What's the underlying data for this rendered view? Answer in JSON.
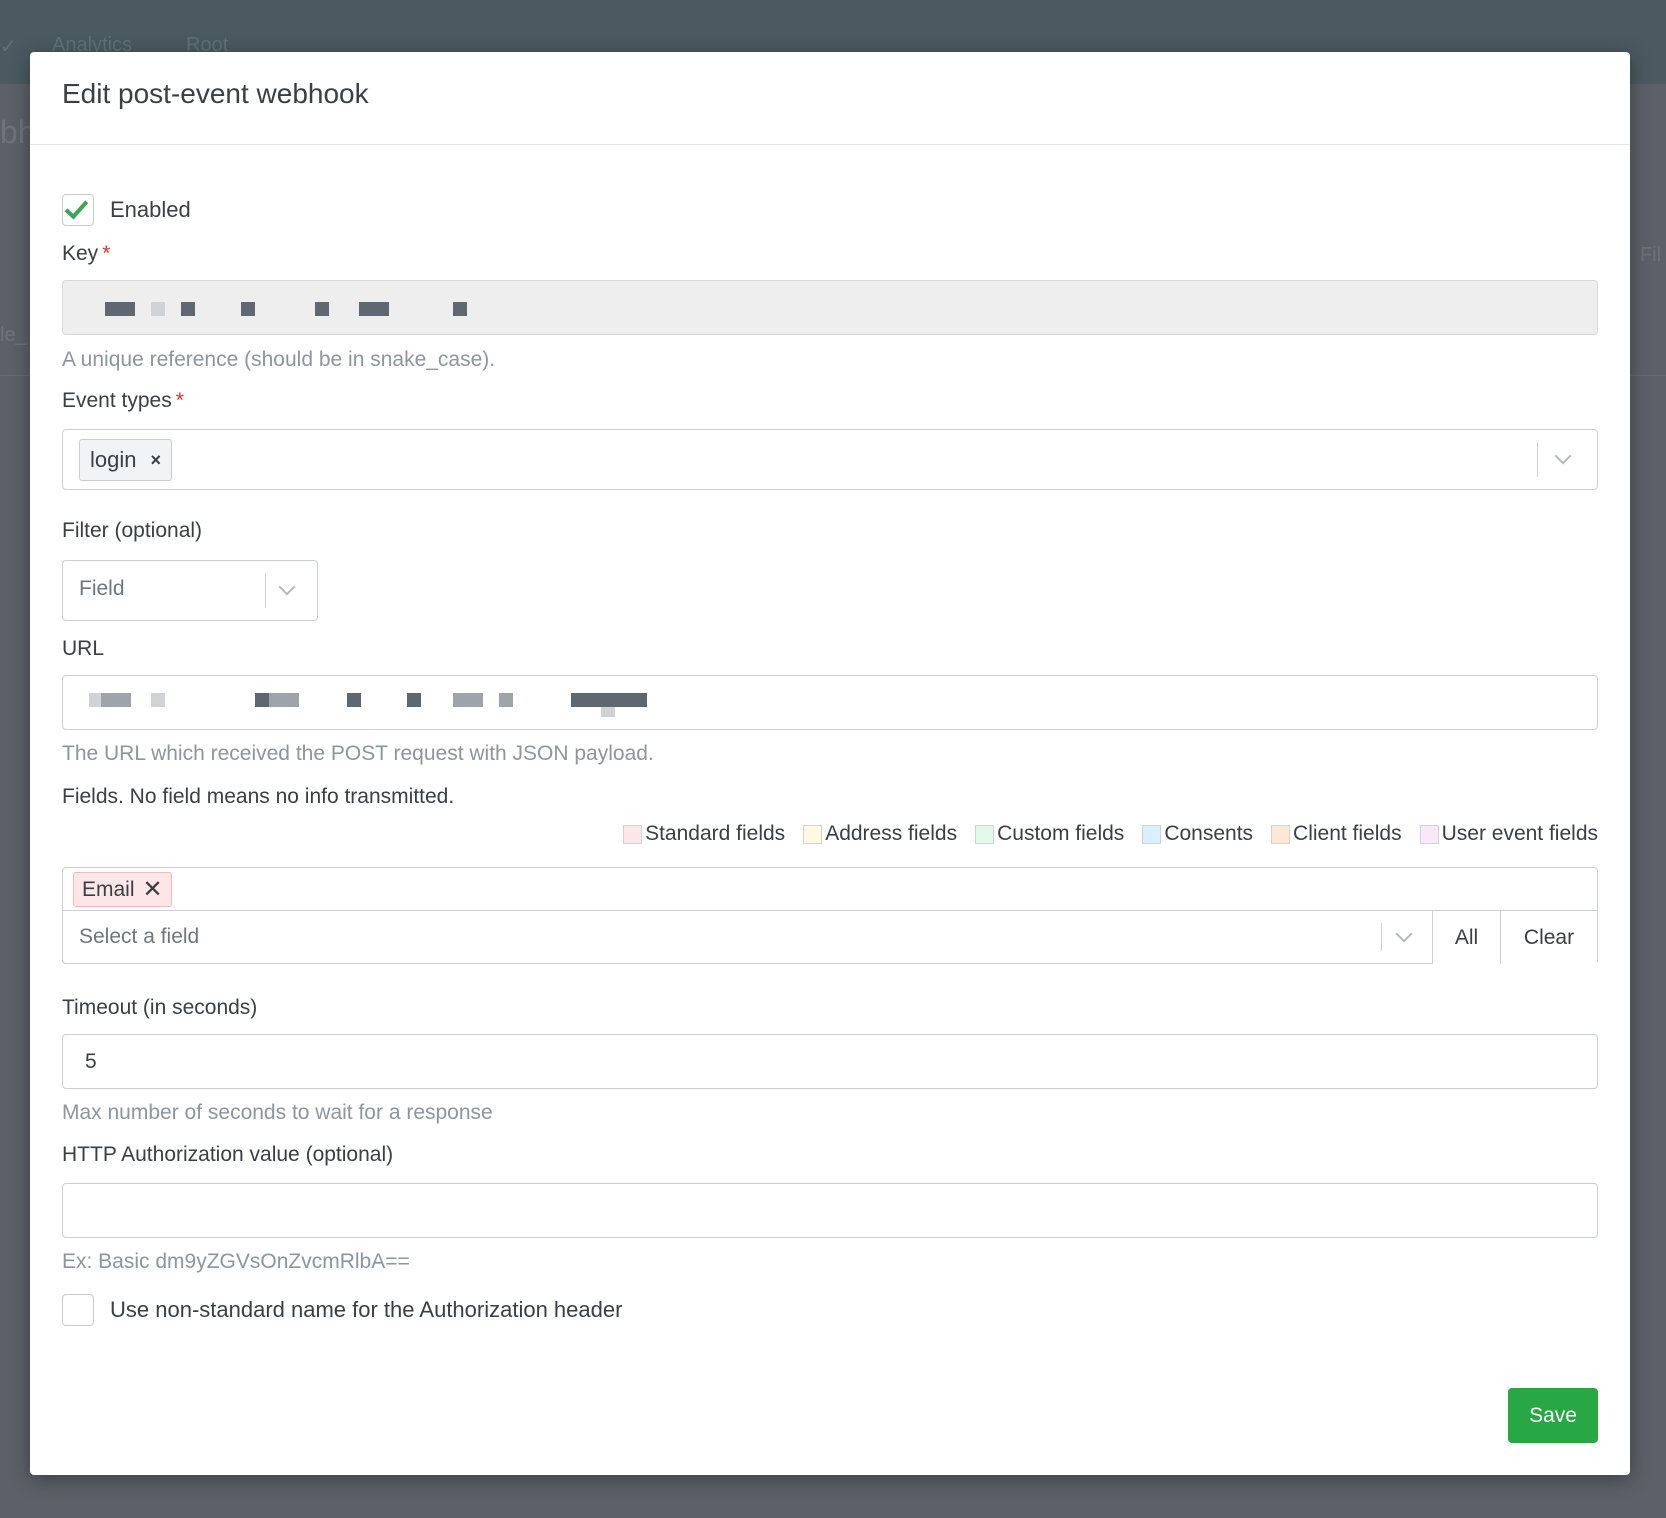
{
  "background": {
    "nav": [
      "Analytics",
      "Root"
    ],
    "page_title_fragment": "bh",
    "side_fragment": "Fil",
    "row_fragment": "le_"
  },
  "modal": {
    "title": "Edit post-event webhook",
    "enabled": {
      "label": "Enabled",
      "checked": true
    },
    "key": {
      "label": "Key",
      "required_mark": "*",
      "help": "A unique reference (should be in snake_case)."
    },
    "event_types": {
      "label": "Event types",
      "required_mark": "*",
      "selected": [
        {
          "label": "login",
          "remove_glyph": "×"
        }
      ]
    },
    "filter": {
      "label": "Filter (optional)",
      "placeholder": "Field"
    },
    "url": {
      "label": "URL",
      "help": "The URL which received the POST request with JSON payload."
    },
    "fields": {
      "label": "Fields. No field means no info transmitted.",
      "legend": [
        {
          "label": "Standard fields",
          "color": "#fde6e8"
        },
        {
          "label": "Address fields",
          "color": "#fdf9e3"
        },
        {
          "label": "Custom fields",
          "color": "#e2f8e9"
        },
        {
          "label": "Consents",
          "color": "#dcefff"
        },
        {
          "label": "Client fields",
          "color": "#fde8d8"
        },
        {
          "label": "User event fields",
          "color": "#f9e8f9"
        }
      ],
      "selected": [
        {
          "label": "Email",
          "remove_glyph": "✕"
        }
      ],
      "select_placeholder": "Select a field",
      "all_label": "All",
      "clear_label": "Clear"
    },
    "timeout": {
      "label": "Timeout (in seconds)",
      "value": "5",
      "help": "Max number of seconds to wait for a response"
    },
    "auth": {
      "label": "HTTP Authorization value (optional)",
      "value": "",
      "help": "Ex: Basic dm9yZGVsOnZvcmRlbA=="
    },
    "nonstandard_header": {
      "label": "Use non-standard name for the Authorization header",
      "checked": false
    },
    "save_label": "Save",
    "colors": {
      "primary": "#28a745",
      "required": "#dd3333"
    }
  }
}
